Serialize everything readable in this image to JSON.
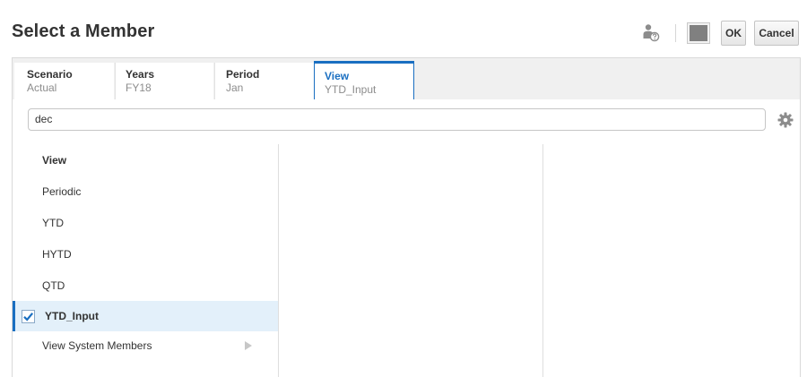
{
  "dialog": {
    "title": "Select a Member"
  },
  "toolbar": {
    "ok_label": "OK",
    "cancel_label": "Cancel"
  },
  "tabs": [
    {
      "label": "Scenario",
      "value": "Actual"
    },
    {
      "label": "Years",
      "value": "FY18"
    },
    {
      "label": "Period",
      "value": "Jan"
    },
    {
      "label": "View",
      "value": "YTD_Input"
    }
  ],
  "search": {
    "value": "dec"
  },
  "members": {
    "header": "View",
    "items": [
      "Periodic",
      "YTD",
      "HYTD",
      "QTD"
    ],
    "selected": "YTD_Input",
    "system": "View System Members"
  },
  "colors": {
    "accent": "#1a6fc1",
    "selected_bg": "#e3f0fa"
  }
}
